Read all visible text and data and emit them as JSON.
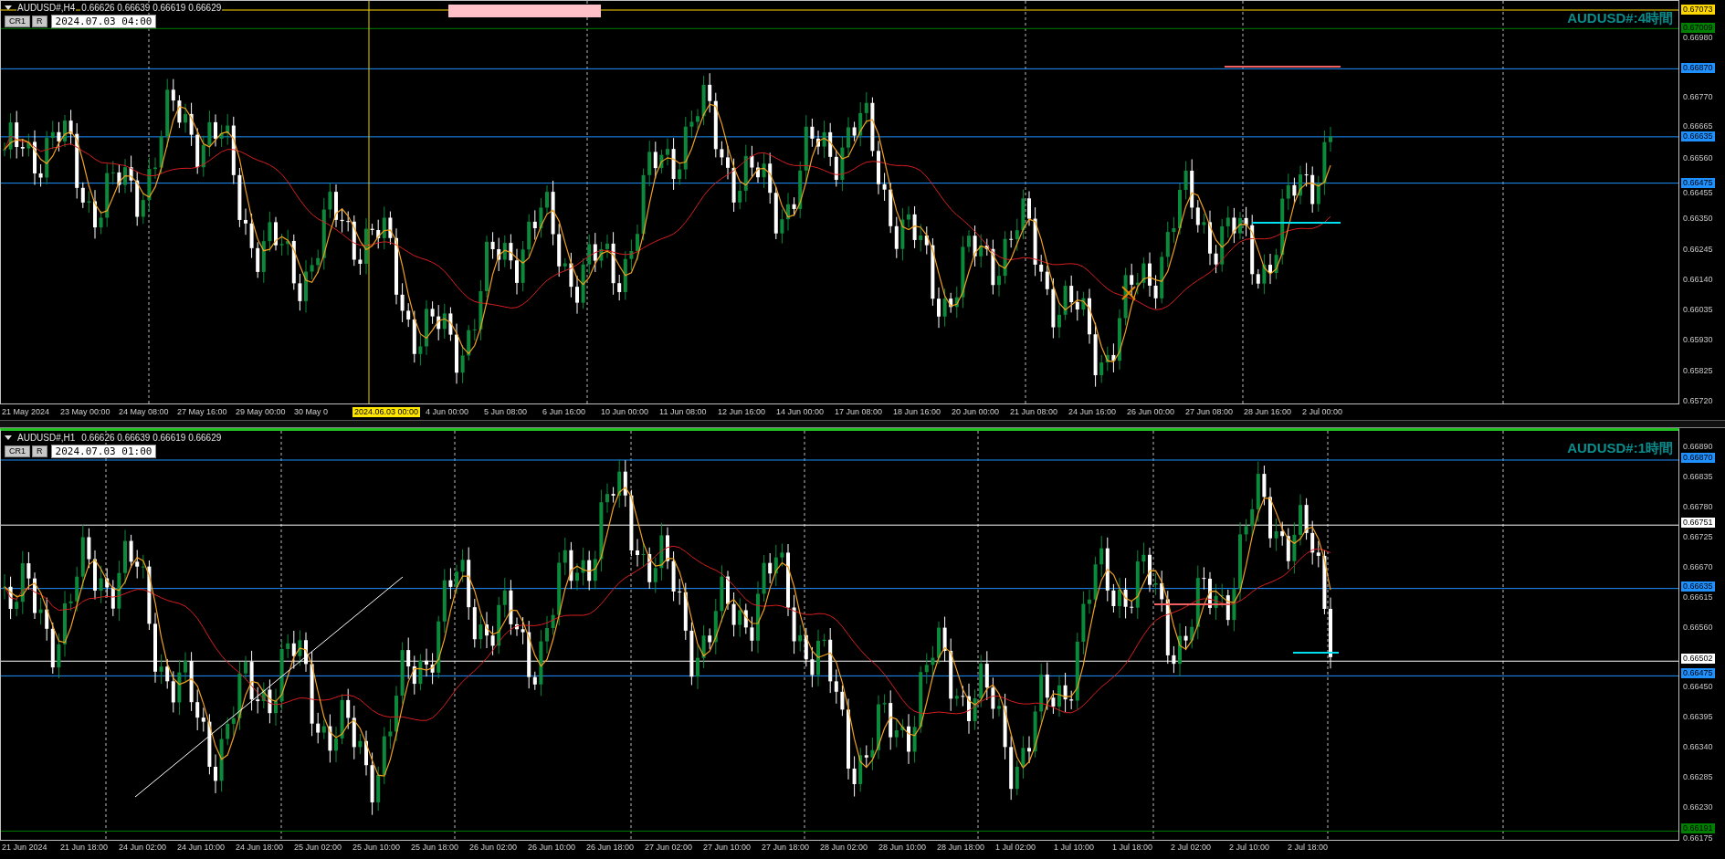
{
  "panes": [
    {
      "symbol": "AUDUSD#,H4",
      "ohlc": "0.66626 0.66639 0.66619 0.66629",
      "buttons": [
        "CR1",
        "R"
      ],
      "time_field": "2024.07.03 04:00",
      "label": "AUDUSD#:4時間",
      "price_ticks": [
        "0.66980",
        "0.66770",
        "0.66665",
        "0.66560",
        "0.66455",
        "0.66350",
        "0.66245",
        "0.66140",
        "0.66035",
        "0.65930",
        "0.65825",
        "0.65720"
      ],
      "levels": [
        {
          "price": "0.67073",
          "color": "#ffd700"
        },
        {
          "price": "0.67009",
          "color": "#008000"
        },
        {
          "price": "0.66870",
          "color": "#1e90ff"
        },
        {
          "price": "0.66635",
          "color": "#1e90ff"
        },
        {
          "price": "0.66475",
          "color": "#1e90ff"
        }
      ],
      "time_labels": [
        {
          "text": "21 May 2024",
          "highlighted": false
        },
        {
          "text": "23 May 00:00",
          "highlighted": false
        },
        {
          "text": "24 May 08:00",
          "highlighted": false
        },
        {
          "text": "27 May 16:00",
          "highlighted": false
        },
        {
          "text": "29 May 00:00",
          "highlighted": false
        },
        {
          "text": "30 May 0",
          "highlighted": false
        },
        {
          "text": "2024.06.03 00:00",
          "highlighted": true
        },
        {
          "text": "4 Jun 00:00",
          "highlighted": false
        },
        {
          "text": "5 Jun 08:00",
          "highlighted": false
        },
        {
          "text": "6 Jun 16:00",
          "highlighted": false
        },
        {
          "text": "10 Jun 00:00",
          "highlighted": false
        },
        {
          "text": "11 Jun 08:00",
          "highlighted": false
        },
        {
          "text": "12 Jun 16:00",
          "highlighted": false
        },
        {
          "text": "14 Jun 00:00",
          "highlighted": false
        },
        {
          "text": "17 Jun 08:00",
          "highlighted": false
        },
        {
          "text": "18 Jun 16:00",
          "highlighted": false
        },
        {
          "text": "20 Jun 00:00",
          "highlighted": false
        },
        {
          "text": "21 Jun 08:00",
          "highlighted": false
        },
        {
          "text": "24 Jun 16:00",
          "highlighted": false
        },
        {
          "text": "26 Jun 00:00",
          "highlighted": false
        },
        {
          "text": "27 Jun 08:00",
          "highlighted": false
        },
        {
          "text": "28 Jun 16:00",
          "highlighted": false
        },
        {
          "text": "2 Jul 00:00",
          "highlighted": false
        }
      ]
    },
    {
      "symbol": "AUDUSD#,H1",
      "ohlc": "0.66626 0.66639 0.66619 0.66629",
      "buttons": [
        "CR1",
        "R"
      ],
      "time_field": "2024.07.03 01:00",
      "label": "AUDUSD#:1時間",
      "price_ticks": [
        "0.66890",
        "0.66835",
        "0.66780",
        "0.66725",
        "0.66670",
        "0.66615",
        "0.66560",
        "0.66450",
        "0.66395",
        "0.66340",
        "0.66285",
        "0.66230",
        "0.66175"
      ],
      "levels": [
        {
          "price": "0.66870",
          "color": "#1e90ff"
        },
        {
          "price": "0.66751",
          "color": "#ffffff"
        },
        {
          "price": "0.66635",
          "color": "#1e90ff"
        },
        {
          "price": "0.66502",
          "color": "#ffffff"
        },
        {
          "price": "0.66475",
          "color": "#1e90ff"
        },
        {
          "price": "0.66191",
          "color": "#008000"
        }
      ],
      "time_labels": [
        {
          "text": "21 Jun 2024",
          "highlighted": false
        },
        {
          "text": "21 Jun 18:00",
          "highlighted": false
        },
        {
          "text": "24 Jun 02:00",
          "highlighted": false
        },
        {
          "text": "24 Jun 10:00",
          "highlighted": false
        },
        {
          "text": "24 Jun 18:00",
          "highlighted": false
        },
        {
          "text": "25 Jun 02:00",
          "highlighted": false
        },
        {
          "text": "25 Jun 10:00",
          "highlighted": false
        },
        {
          "text": "25 Jun 18:00",
          "highlighted": false
        },
        {
          "text": "26 Jun 02:00",
          "highlighted": false
        },
        {
          "text": "26 Jun 10:00",
          "highlighted": false
        },
        {
          "text": "26 Jun 18:00",
          "highlighted": false
        },
        {
          "text": "27 Jun 02:00",
          "highlighted": false
        },
        {
          "text": "27 Jun 10:00",
          "highlighted": false
        },
        {
          "text": "27 Jun 18:00",
          "highlighted": false
        },
        {
          "text": "28 Jun 02:00",
          "highlighted": false
        },
        {
          "text": "28 Jun 10:00",
          "highlighted": false
        },
        {
          "text": "28 Jun 18:00",
          "highlighted": false
        },
        {
          "text": "1 Jul 02:00",
          "highlighted": false
        },
        {
          "text": "1 Jul 10:00",
          "highlighted": false
        },
        {
          "text": "1 Jul 18:00",
          "highlighted": false
        },
        {
          "text": "2 Jul 02:00",
          "highlighted": false
        },
        {
          "text": "2 Jul 10:00",
          "highlighted": false
        },
        {
          "text": "2 Jul 18:00",
          "highlighted": false
        }
      ]
    }
  ]
}
